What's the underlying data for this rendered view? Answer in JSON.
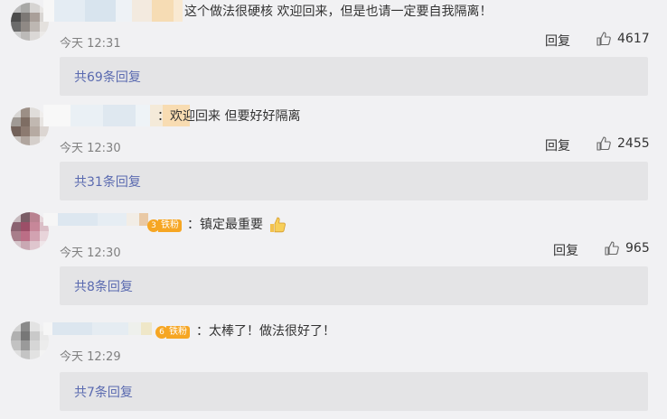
{
  "comments": [
    {
      "text": "这个做法很硬核 欢迎回来，但是也请一定要自我隔离！",
      "time": "今天 12:31",
      "reply_label": "回复",
      "likes": "4617",
      "thread_label": "共69条回复"
    },
    {
      "text": "：欢迎回来 但要好好隔离",
      "time": "今天 12:30",
      "reply_label": "回复",
      "likes": "2455",
      "thread_label": "共31条回复"
    },
    {
      "fan_badge": "铁粉",
      "fan_level": "3",
      "text": "：镇定最重要",
      "time": "今天 12:30",
      "reply_label": "回复",
      "likes": "965",
      "thread_label": "共8条回复"
    },
    {
      "fan_badge": "铁粉",
      "fan_level": "6",
      "text": "：太棒了！做法很好了！",
      "time": "今天 12:29",
      "reply_label": "回复",
      "likes": "",
      "thread_label": "共7条回复"
    }
  ],
  "colors": {
    "background": "#f1f1f3",
    "thread_bg": "#e4e4e6",
    "thread_text": "#5a6ab0",
    "fan_badge": "#f6a623"
  },
  "icons": {
    "like": "thumbs-up-icon",
    "emoji": "thumbs-up-emoji"
  }
}
